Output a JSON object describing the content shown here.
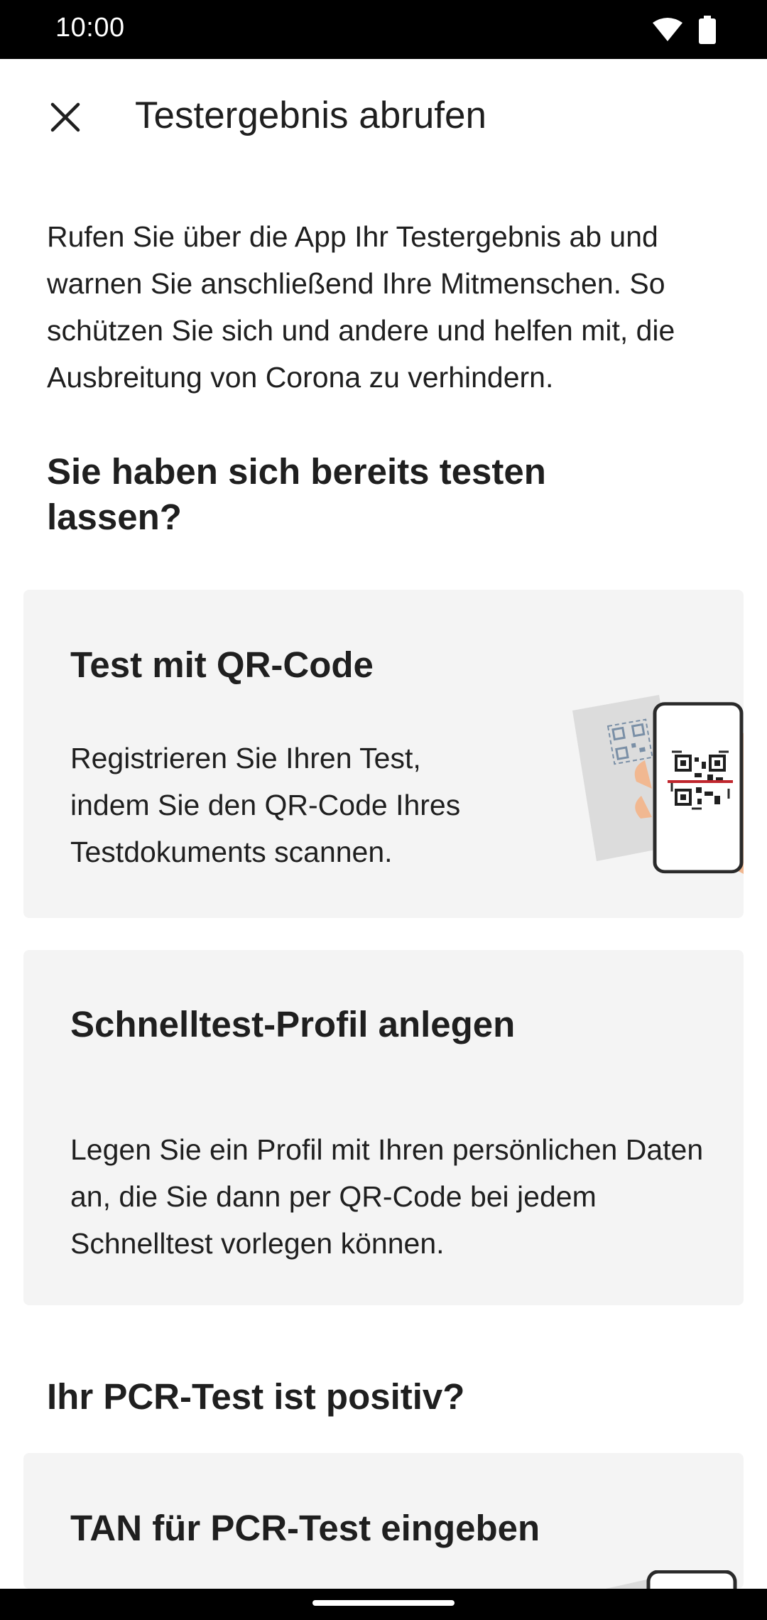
{
  "status_bar": {
    "time": "10:00",
    "icons": [
      "wifi-icon",
      "battery-icon"
    ]
  },
  "app_bar": {
    "close_icon": "close-icon",
    "title": "Testergebnis abrufen"
  },
  "intro": {
    "text": "Rufen Sie über die App Ihr Testergebnis ab und warnen Sie anschließend Ihre Mitmenschen. So schützen Sie sich und andere und helfen mit, die Ausbreitung von Corona zu verhindern."
  },
  "section_tested": {
    "heading": "Sie haben sich bereits testen lassen?"
  },
  "card_qr": {
    "title": "Test mit QR-Code",
    "text": "Registrieren Sie Ihren Test, indem Sie den QR-Code Ihres Testdokuments scannen.",
    "illustration": "phone-scanning-qr-illustration"
  },
  "card_rapid": {
    "title": "Schnelltest-Profil anlegen",
    "text": "Legen Sie ein Profil mit Ihren persönlichen Daten an, die Sie dann per QR-Code bei jedem Schnelltest vorlegen können."
  },
  "section_pcr": {
    "heading": "Ihr PCR-Test ist positiv?"
  },
  "card_tan": {
    "title": "TAN für PCR-Test eingeben"
  },
  "colors": {
    "card_background": "#f4f4f4",
    "scan_line": "#c0262d",
    "hand": "#f1b891"
  }
}
